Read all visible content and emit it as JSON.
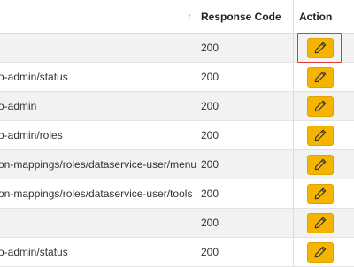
{
  "table": {
    "header": {
      "path_label": "",
      "response_code_label": "Response Code",
      "action_label": "Action",
      "sort_icon": "sort-arrow-up-icon"
    },
    "rows": [
      {
        "path": "",
        "code": "200"
      },
      {
        "path": "o-admin/status",
        "code": "200"
      },
      {
        "path": "o-admin",
        "code": "200"
      },
      {
        "path": "o-admin/roles",
        "code": "200"
      },
      {
        "path": "on-mappings/roles/dataservice-user/menus",
        "code": "200"
      },
      {
        "path": "on-mappings/roles/dataservice-user/tools",
        "code": "200"
      },
      {
        "path": "",
        "code": "200"
      },
      {
        "path": "o-admin/status",
        "code": "200"
      }
    ],
    "edit_icon": "pencil-icon"
  },
  "colors": {
    "button": "#f5b400",
    "highlight": "#e53935",
    "stripe": "#f2f2f2"
  }
}
